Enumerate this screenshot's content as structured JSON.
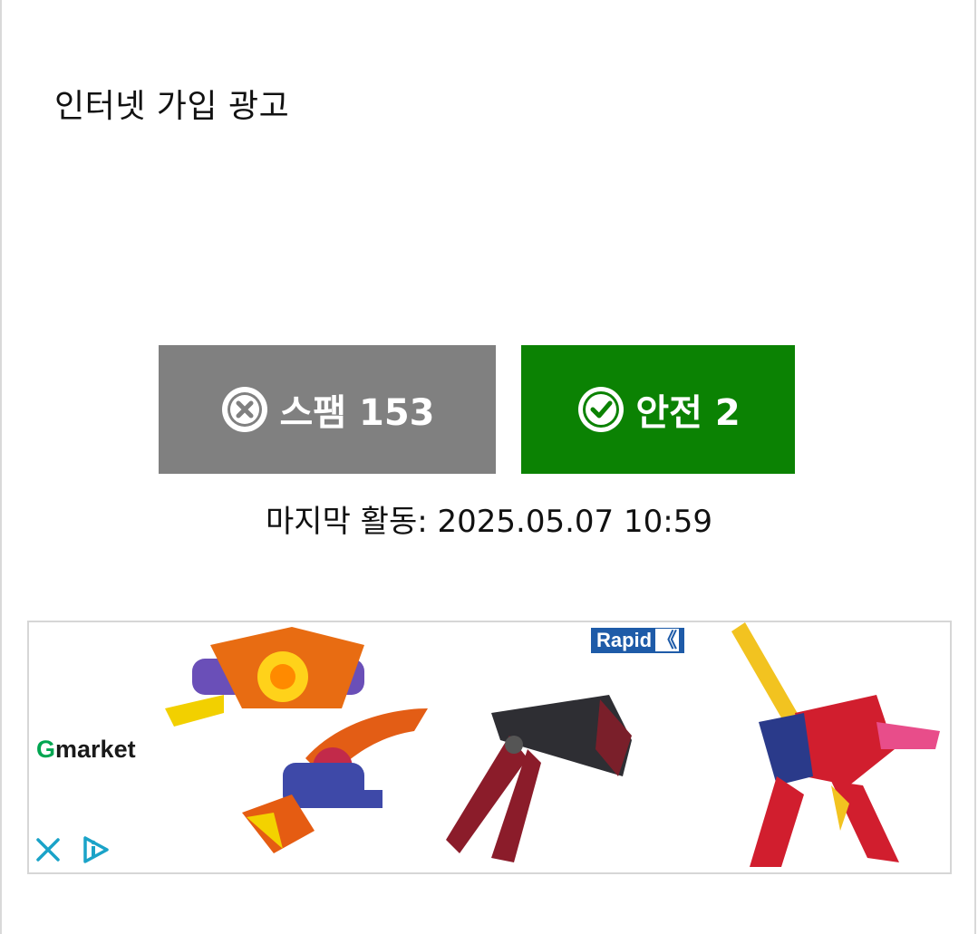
{
  "post": {
    "title": "인터넷 가입 광고"
  },
  "votes": {
    "spam_label": "스팸 153",
    "safe_label": "안전 2",
    "spam_color": "#808080",
    "safe_color": "#0b8203"
  },
  "activity": {
    "last_activity": "마지막 활동: 2025.05.07 10:59"
  },
  "ad": {
    "brand_g": "G",
    "brand_rest": "market",
    "rapid_logo": "Rapid",
    "rapid_chevrons": "《",
    "icons": [
      "ad-close-icon",
      "ad-choices-icon"
    ]
  }
}
